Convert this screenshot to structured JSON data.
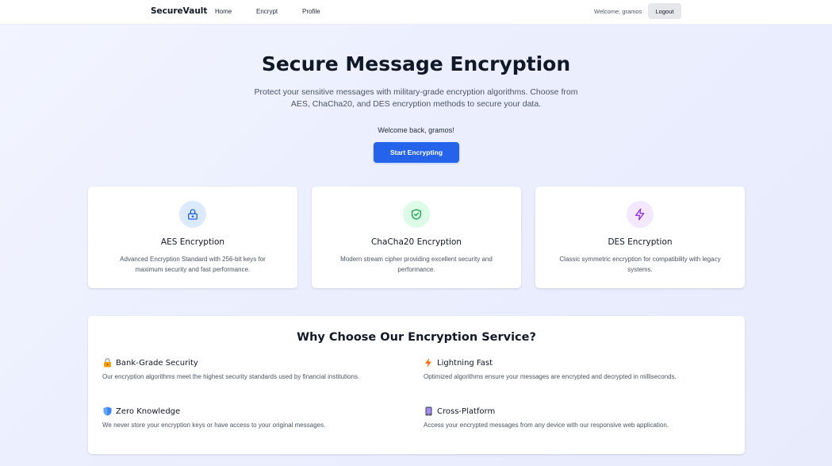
{
  "nav": {
    "brand": "SecureVault",
    "links": [
      "Home",
      "Encrypt",
      "Profile"
    ],
    "welcome": "Welcome, gramos",
    "logout": "Logout"
  },
  "hero": {
    "title": "Secure Message Encryption",
    "subtitle": "Protect your sensitive messages with military-grade encryption algorithms. Choose from AES, ChaCha20, and DES encryption methods to secure your data.",
    "welcome": "Welcome back, gramos!",
    "cta": "Start Encrypting"
  },
  "cards": [
    {
      "icon": "lock-icon",
      "title": "AES Encryption",
      "desc": "Advanced Encryption Standard with 256-bit keys for maximum security and fast performance.",
      "bg": "#dbeafe",
      "color": "#2563eb"
    },
    {
      "icon": "shield-check-icon",
      "title": "ChaCha20 Encryption",
      "desc": "Modern stream cipher providing excellent security and performance.",
      "bg": "#dcfce7",
      "color": "#16a34a"
    },
    {
      "icon": "lightning-icon",
      "title": "DES Encryption",
      "desc": "Classic symmetric encryption for compatibility with legacy systems.",
      "bg": "#f3e8ff",
      "color": "#9333ea"
    }
  ],
  "features": {
    "title": "Why Choose Our Encryption Service?",
    "items": [
      {
        "icon": "padlock-emoji-icon",
        "title": "Bank-Grade Security",
        "desc": "Our encryption algorithms meet the highest security standards used by financial institutions."
      },
      {
        "icon": "lightning-emoji-icon",
        "title": "Lightning Fast",
        "desc": "Optimized algorithms ensure your messages are encrypted and decrypted in milliseconds."
      },
      {
        "icon": "shield-emoji-icon",
        "title": "Zero Knowledge",
        "desc": "We never store your encryption keys or have access to your original messages."
      },
      {
        "icon": "phone-emoji-icon",
        "title": "Cross-Platform",
        "desc": "Access your encrypted messages from any device with our responsive web application."
      }
    ]
  },
  "colors": {
    "primary": "#2563eb",
    "background": "#eef1fd",
    "card": "#ffffff",
    "text": "#111827",
    "muted": "#4b5563"
  }
}
